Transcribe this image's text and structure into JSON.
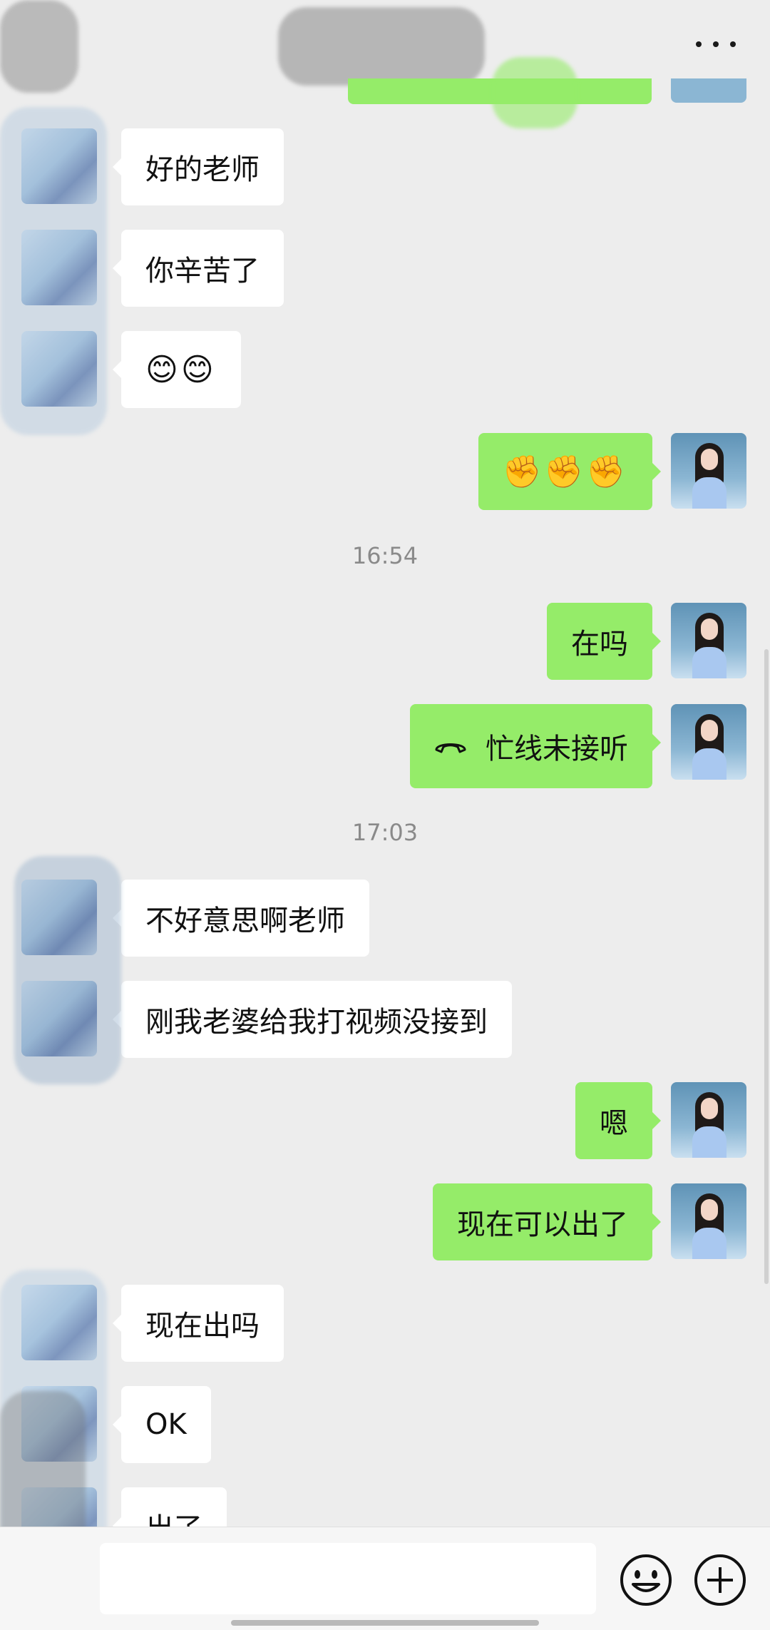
{
  "header": {
    "more_icon": "more-icon"
  },
  "messages": [
    {
      "id": "m1",
      "side": "in",
      "text": "好的老师"
    },
    {
      "id": "m2",
      "side": "in",
      "text": "你辛苦了"
    },
    {
      "id": "m3",
      "side": "in",
      "text": "😊😊"
    },
    {
      "id": "m4",
      "side": "out",
      "text": "✊✊✊"
    },
    {
      "id": "t1",
      "type": "time",
      "text": "16:54"
    },
    {
      "id": "m5",
      "side": "out",
      "text": "在吗"
    },
    {
      "id": "m6",
      "side": "out",
      "text": "忙线未接听",
      "icon": "phone-hangup-icon"
    },
    {
      "id": "t2",
      "type": "time",
      "text": "17:03"
    },
    {
      "id": "m7",
      "side": "in",
      "text": "不好意思啊老师"
    },
    {
      "id": "m8",
      "side": "in",
      "text": "刚我老婆给我打视频没接到"
    },
    {
      "id": "m9",
      "side": "out",
      "text": "嗯"
    },
    {
      "id": "m10",
      "side": "out",
      "text": "现在可以出了"
    },
    {
      "id": "m11",
      "side": "in",
      "text": "现在出吗"
    },
    {
      "id": "m12",
      "side": "in",
      "text": "OK"
    },
    {
      "id": "m13",
      "side": "in",
      "text": "出了"
    }
  ],
  "input_bar": {
    "value": "",
    "emoji_icon": "emoji-icon",
    "plus_icon": "plus-icon"
  },
  "colors": {
    "background": "#ededed",
    "outgoing_bubble": "#95ec69",
    "incoming_bubble": "#ffffff",
    "timestamp": "#8a8a8a"
  }
}
